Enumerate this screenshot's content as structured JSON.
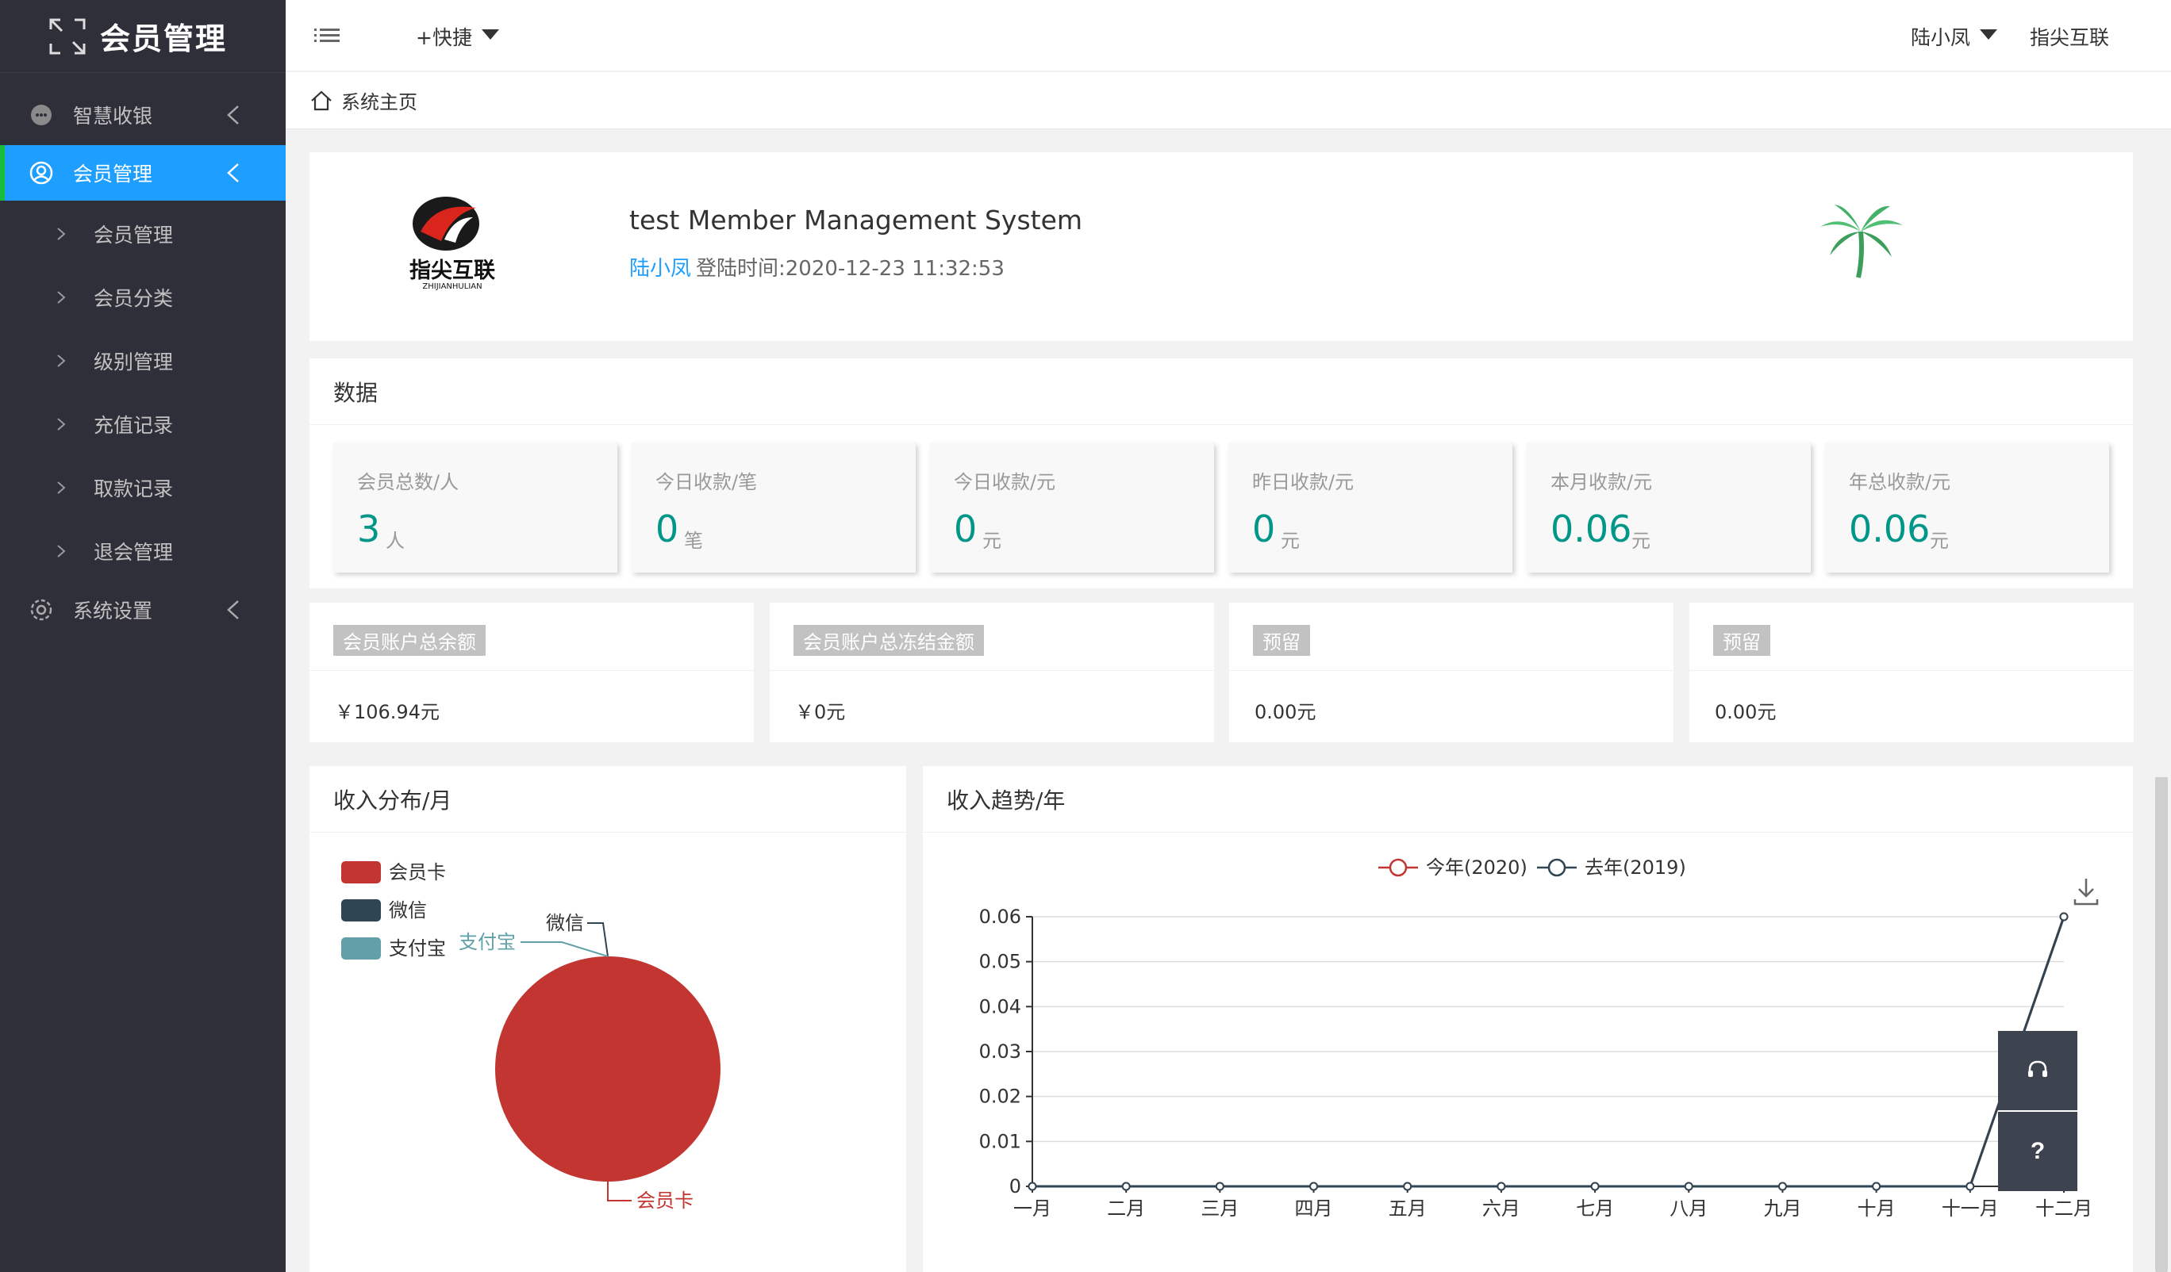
{
  "sidebar": {
    "logo_text": "会员管理",
    "items": [
      {
        "label": "智慧收银"
      },
      {
        "label": "会员管理"
      },
      {
        "label": "系统设置"
      }
    ],
    "sub_items": [
      {
        "label": "会员管理"
      },
      {
        "label": "会员分类"
      },
      {
        "label": "级别管理"
      },
      {
        "label": "充值记录"
      },
      {
        "label": "取款记录"
      },
      {
        "label": "退会管理"
      }
    ],
    "active_color": "#1e9fff"
  },
  "header": {
    "quick_label": "+快捷",
    "user_name": "陆小凤",
    "company": "指尖互联"
  },
  "breadcrumb": {
    "home_label": "系统主页"
  },
  "welcome": {
    "title": "test Member Management System",
    "user": "陆小凤",
    "login_time": "登陆时间:2020-12-23 11:32:53",
    "logo_text": "指尖互联",
    "logo_sub": "ZHIJIANHULIAN"
  },
  "data_section": {
    "title": "数据",
    "stats": [
      {
        "label": "会员总数/人",
        "value": "3",
        "unit": "人"
      },
      {
        "label": "今日收款/笔",
        "value": "0",
        "unit": "笔"
      },
      {
        "label": "今日收款/元",
        "value": "0",
        "unit": "元"
      },
      {
        "label": "昨日收款/元",
        "value": "0",
        "unit": "元"
      },
      {
        "label": "本月收款/元",
        "value": "0.06",
        "unit": "元"
      },
      {
        "label": "年总收款/元",
        "value": "0.06",
        "unit": "元"
      }
    ]
  },
  "accounts": [
    {
      "label": "会员账户总余额",
      "value": "￥106.94元"
    },
    {
      "label": "会员账户总冻结金额",
      "value": "￥0元"
    },
    {
      "label": "预留",
      "value": "0.00元"
    },
    {
      "label": "预留",
      "value": "0.00元"
    }
  ],
  "pie_section": {
    "title": "收入分布/月"
  },
  "line_section": {
    "title": "收入趋势/年"
  },
  "float_widget": {
    "help_label": "?"
  },
  "chart_data": [
    {
      "type": "pie",
      "title": "收入分布/月",
      "legend_position": "top-left",
      "categories": [
        "会员卡",
        "微信",
        "支付宝"
      ],
      "values": [
        0.06,
        0,
        0
      ],
      "colors": [
        "#c23531",
        "#2f4554",
        "#61a0a8"
      ]
    },
    {
      "type": "line",
      "title": "收入趋势/年",
      "legend_position": "top-center",
      "categories": [
        "一月",
        "二月",
        "三月",
        "四月",
        "五月",
        "六月",
        "七月",
        "八月",
        "九月",
        "十月",
        "十一月",
        "十二月"
      ],
      "series": [
        {
          "name": "今年(2020)",
          "color": "#c23531",
          "values": [
            0,
            0,
            0,
            0,
            0,
            0,
            0,
            0,
            0,
            0,
            0,
            0.06
          ]
        },
        {
          "name": "去年(2019)",
          "color": "#2f4554",
          "values": [
            0,
            0,
            0,
            0,
            0,
            0,
            0,
            0,
            0,
            0,
            0,
            0.06
          ]
        }
      ],
      "yticks": [
        "0",
        "0.01",
        "0.02",
        "0.03",
        "0.04",
        "0.05",
        "0.06"
      ],
      "ylim": [
        0,
        0.06
      ],
      "grid": true
    }
  ]
}
